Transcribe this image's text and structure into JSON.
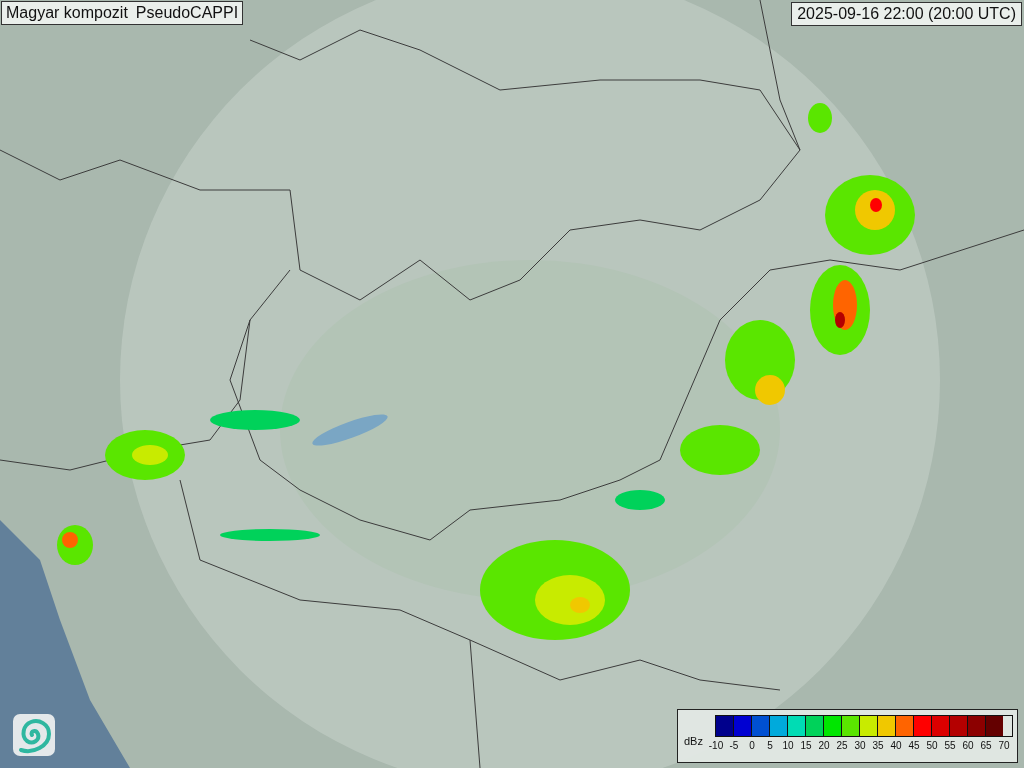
{
  "title": {
    "product": "Magyar kompozit",
    "mode": "PseudoCAPPI"
  },
  "timestamp": "2025-09-16 22:00 (20:00 UTC)",
  "legend": {
    "unit": "dBz",
    "bins": [
      {
        "color": "#00008c"
      },
      {
        "color": "#0000d2"
      },
      {
        "color": "#0050d2"
      },
      {
        "color": "#00aadc"
      },
      {
        "color": "#00dcb4"
      },
      {
        "color": "#00d25a"
      },
      {
        "color": "#00e600"
      },
      {
        "color": "#5ae600"
      },
      {
        "color": "#c8eb00"
      },
      {
        "color": "#f0c800"
      },
      {
        "color": "#ff6400"
      },
      {
        "color": "#ff0000"
      },
      {
        "color": "#dc0000"
      },
      {
        "color": "#b40000"
      },
      {
        "color": "#8c0000"
      },
      {
        "color": "#640000"
      }
    ],
    "ticks": [
      "-10",
      "-5",
      "0",
      "5",
      "10",
      "15",
      "20",
      "25",
      "30",
      "35",
      "40",
      "45",
      "50",
      "55",
      "60",
      "65",
      "70"
    ]
  }
}
